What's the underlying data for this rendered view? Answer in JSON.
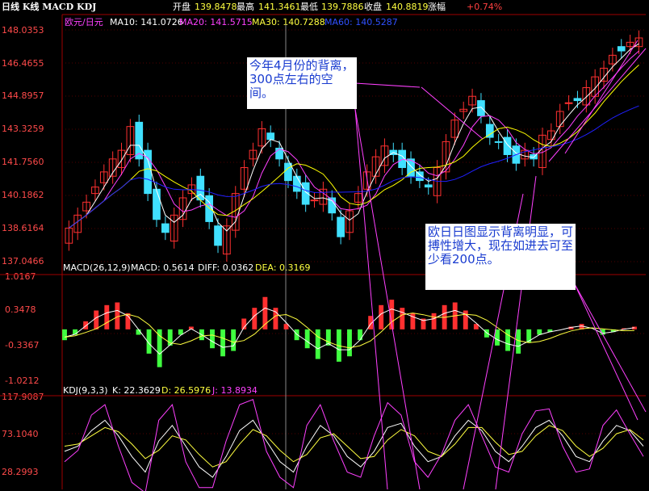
{
  "header": {
    "title": "日线 K线 MACD KDJ",
    "open_label": "开盘",
    "open_value": "139.8478",
    "high_label": "最高",
    "high_value": "141.3461",
    "low_label": "最低",
    "low_value": "139.7886",
    "close_label": "收盘",
    "close_value": "140.8819",
    "change_label": "涨幅",
    "change_value": "+0.74%"
  },
  "price_panel": {
    "symbol": "欧元/日元",
    "ma10": "MA10: 141.0726",
    "ma20": "MA20: 141.5715",
    "ma30": "MA30: 140.7288",
    "ma60": "MA60: 140.5287",
    "y_labels": [
      "148.0353",
      "146.4655",
      "144.8957",
      "143.3259",
      "141.7560",
      "140.1862",
      "138.6164",
      "137.0466"
    ]
  },
  "macd_panel": {
    "label": "MACD(26,12,9)",
    "macd": "MACD: 0.5614",
    "diff": "DIFF: 0.0362",
    "dea": "DEA: 0.3169",
    "y_labels": [
      "1.0167",
      "0.3478",
      "-0.3367",
      "-1.0212"
    ]
  },
  "kdj_panel": {
    "label": "KDJ(9,3,3)",
    "k": "K: 22.3629",
    "d": "D: 26.5976",
    "j": "J: 13.8934",
    "y_labels": [
      "117.9087",
      "73.1040",
      "28.2993"
    ]
  },
  "annotations": [
    "今年4月份的背离，300点左右的空间。",
    "欧日日图显示背离明显，可搏性增大，现在如进去可至少看200点。"
  ],
  "colors": {
    "up": "#ff3030",
    "down": "#40e0ff",
    "ma10": "#ffffff",
    "ma20": "#ff40ff",
    "ma30": "#ffff00",
    "ma60": "#2020ff",
    "grid": "#a00000",
    "macd_pos": "#ff3030",
    "macd_neg": "#40ff40"
  },
  "chart_data": [
    {
      "type": "candlestick",
      "title": "欧元/日元",
      "ylim": [
        137.0466,
        148.0353
      ],
      "series": [
        {
          "name": "close",
          "values": [
            138.6,
            139.2,
            139.8,
            140.5,
            141.2,
            141.8,
            142.2,
            143.3,
            141.8,
            140.2,
            139.0,
            138.4,
            139.2,
            140.0,
            140.6,
            139.9,
            138.9,
            137.8,
            138.7,
            140.2,
            141.4,
            142.2,
            143.2,
            142.7,
            141.8,
            140.8,
            140.3,
            139.7,
            139.9,
            140.4,
            139.3,
            138.2,
            139.4,
            140.2,
            141.2,
            141.9,
            142.4,
            142.0,
            141.4,
            141.0,
            140.8,
            140.5,
            141.4,
            142.6,
            143.6,
            144.1,
            144.7,
            143.8,
            142.8,
            142.6,
            142.0,
            141.6,
            142.2,
            141.8,
            142.9,
            143.1,
            144.0,
            144.4,
            144.5,
            145.1,
            145.6,
            146.0,
            146.6,
            146.8,
            147.2,
            147.4
          ]
        },
        {
          "name": "MA10",
          "values": []
        },
        {
          "name": "MA20",
          "values": []
        },
        {
          "name": "MA30",
          "values": []
        },
        {
          "name": "MA60",
          "values": []
        }
      ]
    },
    {
      "type": "bar",
      "title": "MACD(26,12,9)",
      "ylim": [
        -1.0212,
        1.0167
      ],
      "series": [
        {
          "name": "MACD",
          "values": [
            -0.2,
            -0.1,
            0.15,
            0.35,
            0.45,
            0.5,
            0.3,
            -0.1,
            -0.45,
            -0.7,
            -0.3,
            -0.1,
            0.05,
            -0.2,
            -0.35,
            -0.5,
            -0.4,
            0.2,
            0.4,
            0.6,
            0.4,
            0.1,
            -0.2,
            -0.35,
            -0.55,
            -0.3,
            -0.6,
            -0.5,
            -0.2,
            0.25,
            0.45,
            0.55,
            0.4,
            0.3,
            0.2,
            0.3,
            0.45,
            0.5,
            0.35,
            0.1,
            -0.15,
            -0.3,
            -0.4,
            -0.45,
            -0.25,
            -0.1,
            -0.05,
            0.0,
            0.05,
            0.1,
            0.0,
            -0.1,
            -0.05,
            0.02,
            0.05
          ]
        }
      ]
    },
    {
      "type": "line",
      "title": "KDJ(9,3,3)",
      "ylim": [
        28.2993,
        117.9087
      ],
      "series": [
        {
          "name": "K",
          "values": [
            65,
            70,
            85,
            95,
            80,
            60,
            45,
            75,
            90,
            70,
            50,
            40,
            60,
            85,
            95,
            75,
            55,
            45,
            70,
            90,
            80,
            60,
            50,
            65,
            88,
            92,
            70,
            55,
            60,
            80,
            95,
            85,
            65,
            55,
            70,
            88,
            95,
            80,
            60,
            55,
            75,
            90,
            85,
            70
          ]
        },
        {
          "name": "D",
          "values": [
            70,
            72,
            80,
            88,
            84,
            72,
            58,
            66,
            80,
            76,
            62,
            50,
            55,
            72,
            86,
            80,
            66,
            55,
            62,
            78,
            82,
            70,
            58,
            60,
            76,
            86,
            80,
            65,
            60,
            72,
            88,
            88,
            74,
            62,
            65,
            80,
            90,
            85,
            70,
            60,
            68,
            82,
            86,
            76
          ]
        },
        {
          "name": "J",
          "values": [
            55,
            66,
            100,
            110,
            70,
            35,
            25,
            95,
            110,
            55,
            30,
            30,
            75,
            110,
            115,
            65,
            40,
            30,
            90,
            110,
            75,
            45,
            40,
            80,
            112,
            100,
            55,
            40,
            62,
            95,
            110,
            80,
            50,
            45,
            82,
            104,
            106,
            70,
            45,
            48,
            90,
            105,
            82,
            60
          ]
        }
      ]
    }
  ]
}
